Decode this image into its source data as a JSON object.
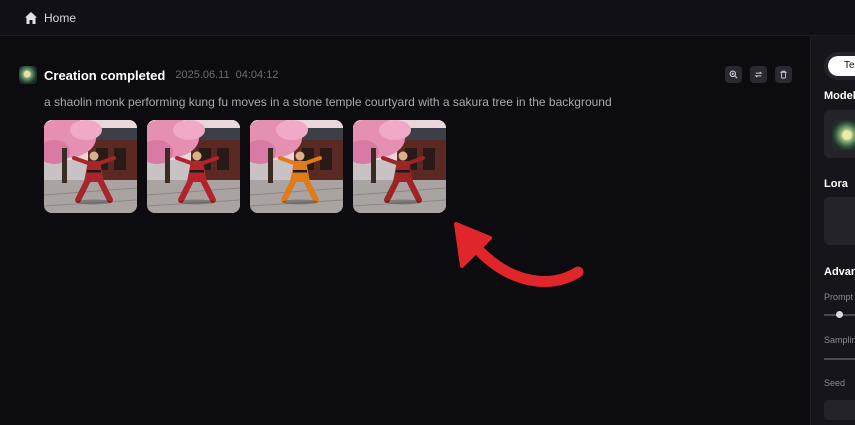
{
  "nav": {
    "home_label": "Home"
  },
  "creation": {
    "title": "Creation completed",
    "date": "2025.06.11",
    "time": "04:04:12",
    "prompt": "a shaolin monk performing kung fu moves in a stone temple courtyard with a sakura tree in the background",
    "actions": [
      {
        "icon": "zoom-in-icon"
      },
      {
        "icon": "regenerate-icon"
      },
      {
        "icon": "delete-icon"
      }
    ],
    "images": [
      {
        "robe_color": "#a8262b"
      },
      {
        "robe_color": "#b3232a"
      },
      {
        "robe_color": "#e07a1a"
      },
      {
        "robe_color": "#9c2426"
      }
    ]
  },
  "right_panel": {
    "tab_label": "Tex",
    "model_heading": "Model",
    "lora_heading": "Lora",
    "advanced_heading": "Advan",
    "prompt_label": "Prompt",
    "sampling_label": "Samplin",
    "seed_label": "Seed"
  },
  "colors": {
    "background": "#0c0b10",
    "panel": "#16151b",
    "annotation": "#e0262b"
  }
}
